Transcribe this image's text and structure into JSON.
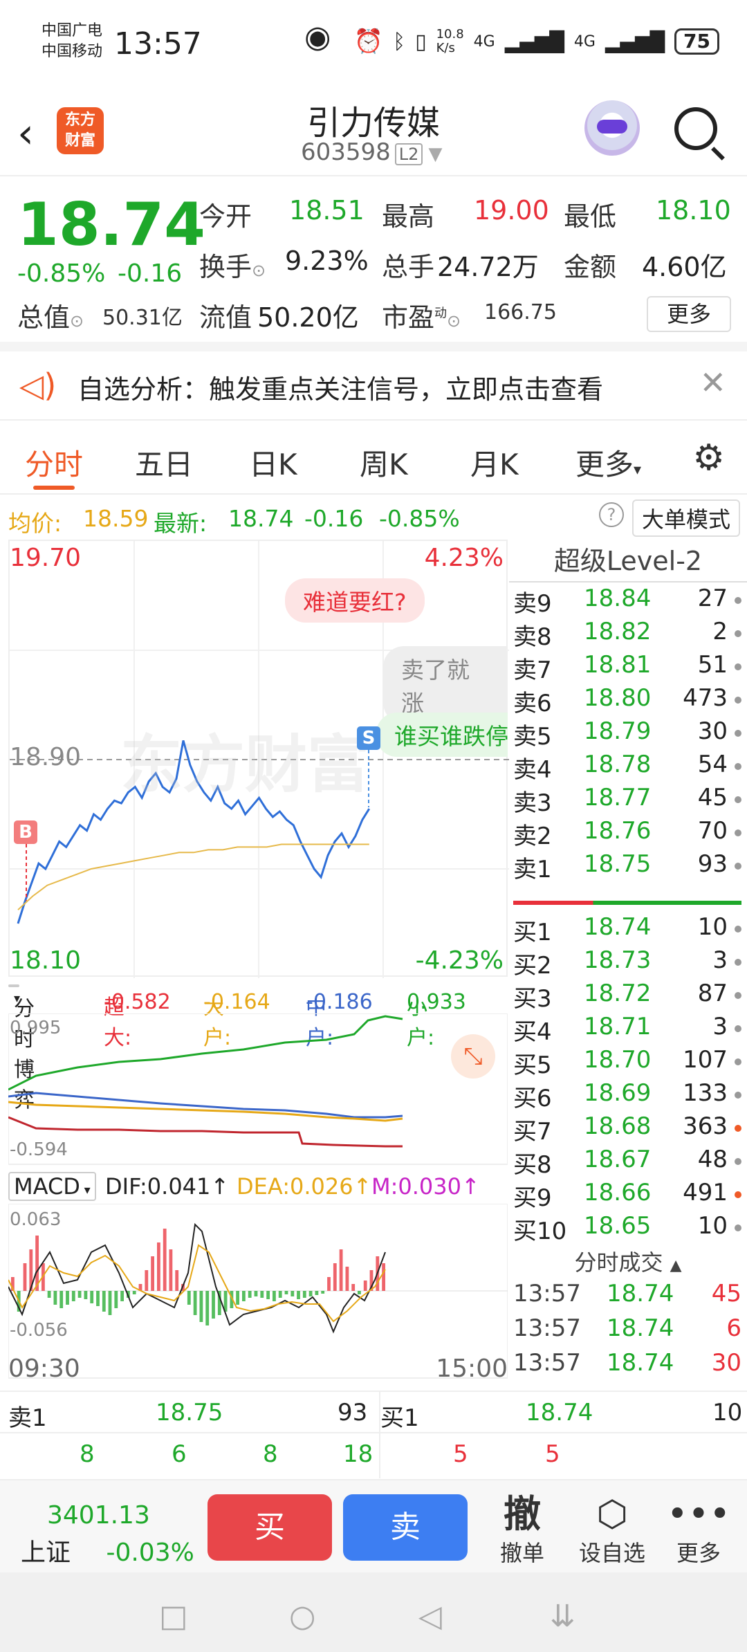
{
  "status": {
    "carrier1": "中国广电",
    "carrier2": "中国移动",
    "time": "13:57",
    "speed": "10.8\nK/s",
    "net1": "4G",
    "net2": "4G",
    "battery": "75"
  },
  "header": {
    "back_icon": "back-arrow-icon",
    "logo_line1": "东方",
    "logo_line2": "财富",
    "title": "引力传媒",
    "code": "603598",
    "level_badge": "L2"
  },
  "quote": {
    "price": "18.74",
    "pct": "-0.85%",
    "change": "-0.16",
    "open_label": "今开",
    "open": "18.51",
    "high_label": "最高",
    "high": "19.00",
    "low_label": "最低",
    "low": "18.10",
    "turnover_label": "换手",
    "turnover": "9.23%",
    "volume_label": "总手",
    "volume": "24.72万",
    "amount_label": "金额",
    "amount": "4.60亿",
    "mktcap_label": "总值",
    "mktcap": "50.31亿",
    "float_label": "流值",
    "float": "50.20亿",
    "pe_label": "市盈",
    "pe_sup": "动",
    "pe": "166.75",
    "more": "更多"
  },
  "alert": {
    "text": "自选分析：触发重点关注信号，立即点击查看"
  },
  "tabs": [
    "分时",
    "五日",
    "日K",
    "周K",
    "月K",
    "更多"
  ],
  "inforow": {
    "avg_label": "均价:",
    "avg": "18.59",
    "latest_label": "最新:",
    "latest": "18.74",
    "chg": "-0.16",
    "pct": "-0.85%",
    "mode_button": "大单模式"
  },
  "chart": {
    "top_price": "19.70",
    "top_pct": "4.23%",
    "mid_price": "18.90",
    "bottom_price": "18.10",
    "bottom_pct": "-4.23%",
    "bubble1": "难道要红?",
    "bubble2": "卖了就涨",
    "bubble3": "谁买谁跌停",
    "marker_b": "B",
    "marker_s": "S",
    "watermark": "东方财富"
  },
  "chart_data": {
    "type": "line",
    "ylim": [
      18.1,
      19.7
    ],
    "series": [
      {
        "values": [
          18.3,
          18.38,
          18.45,
          18.52,
          18.5,
          18.55,
          18.6,
          18.58,
          18.62,
          18.66,
          18.64,
          18.7,
          18.68,
          18.72,
          18.75,
          18.74,
          18.78,
          18.8,
          18.76,
          18.82,
          18.85,
          18.8,
          18.78,
          18.83,
          18.97,
          18.88,
          18.82,
          18.78,
          18.75,
          18.8,
          18.74,
          18.72,
          18.75,
          18.7,
          18.73,
          18.76,
          18.72,
          18.69,
          18.71,
          18.68,
          18.66,
          18.6,
          18.55,
          18.5,
          18.47,
          18.55,
          18.6,
          18.63,
          18.58,
          18.62,
          18.68,
          18.72
        ]
      },
      {
        "values": [
          18.35,
          18.4,
          18.44,
          18.46,
          18.48,
          18.5,
          18.51,
          18.52,
          18.53,
          18.54,
          18.55,
          18.56,
          18.56,
          18.57,
          18.57,
          18.58,
          18.58,
          18.58,
          18.59,
          18.59,
          18.59,
          18.59,
          18.59,
          18.59,
          18.59
        ]
      }
    ]
  },
  "flow": {
    "dropdown": "分时博弈",
    "super_label": "超大:",
    "super": "-0.582",
    "big_label": "大户:",
    "big": "-0.164",
    "mid_label": "中户:",
    "mid": "-0.186",
    "small_label": "小户:",
    "small": "0.933",
    "top": "0.995",
    "bottom": "-0.594"
  },
  "macd": {
    "dropdown": "MACD",
    "dif": "DIF:0.041",
    "dea": "DEA:0.026",
    "m": "M:0.030",
    "top": "0.063",
    "bottom": "-0.056"
  },
  "axis": {
    "start": "09:30",
    "end": "15:00"
  },
  "book": {
    "title": "超级Level-2",
    "asks": [
      {
        "label": "卖9",
        "price": "18.84",
        "qty": "27",
        "dot": "gray"
      },
      {
        "label": "卖8",
        "price": "18.82",
        "qty": "2",
        "dot": "gray"
      },
      {
        "label": "卖7",
        "price": "18.81",
        "qty": "51",
        "dot": "gray"
      },
      {
        "label": "卖6",
        "price": "18.80",
        "qty": "473",
        "dot": "gray"
      },
      {
        "label": "卖5",
        "price": "18.79",
        "qty": "30",
        "dot": "gray"
      },
      {
        "label": "卖4",
        "price": "18.78",
        "qty": "54",
        "dot": "gray"
      },
      {
        "label": "卖3",
        "price": "18.77",
        "qty": "45",
        "dot": "gray"
      },
      {
        "label": "卖2",
        "price": "18.76",
        "qty": "70",
        "dot": "gray"
      },
      {
        "label": "卖1",
        "price": "18.75",
        "qty": "93",
        "dot": "gray"
      }
    ],
    "bids": [
      {
        "label": "买1",
        "price": "18.74",
        "qty": "10",
        "dot": "gray"
      },
      {
        "label": "买2",
        "price": "18.73",
        "qty": "3",
        "dot": "gray"
      },
      {
        "label": "买3",
        "price": "18.72",
        "qty": "87",
        "dot": "gray"
      },
      {
        "label": "买4",
        "price": "18.71",
        "qty": "3",
        "dot": "gray"
      },
      {
        "label": "买5",
        "price": "18.70",
        "qty": "107",
        "dot": "gray"
      },
      {
        "label": "买6",
        "price": "18.69",
        "qty": "133",
        "dot": "gray"
      },
      {
        "label": "买7",
        "price": "18.68",
        "qty": "363",
        "dot": "orange"
      },
      {
        "label": "买8",
        "price": "18.67",
        "qty": "48",
        "dot": "gray"
      },
      {
        "label": "买9",
        "price": "18.66",
        "qty": "491",
        "dot": "orange"
      },
      {
        "label": "买10",
        "price": "18.65",
        "qty": "10",
        "dot": "gray"
      }
    ],
    "trades_title": "分时成交",
    "trades": [
      {
        "time": "13:57",
        "price": "18.74",
        "qty": "45"
      },
      {
        "time": "13:57",
        "price": "18.74",
        "qty": "6"
      },
      {
        "time": "13:57",
        "price": "18.74",
        "qty": "30"
      }
    ]
  },
  "quoterow": {
    "ask_label": "卖1",
    "ask_price": "18.75",
    "ask_qty": "93",
    "bid_label": "买1",
    "bid_price": "18.74",
    "bid_qty": "10",
    "ask_queue": [
      "8",
      "6",
      "8",
      "18"
    ],
    "bid_queue": [
      "5",
      "5"
    ]
  },
  "footer": {
    "index_value": "3401.13",
    "index_name": "上证",
    "index_pct": "-0.03%",
    "buy": "买",
    "sell": "卖",
    "cancel_icon": "撤",
    "cancel": "撤单",
    "watch": "设自选",
    "more": "更多"
  },
  "colors": {
    "up": "#e8303a",
    "down": "#1ea82a",
    "accent": "#ef5a27",
    "buy_btn": "#e8464a",
    "sell_btn": "#3d7ef2"
  }
}
